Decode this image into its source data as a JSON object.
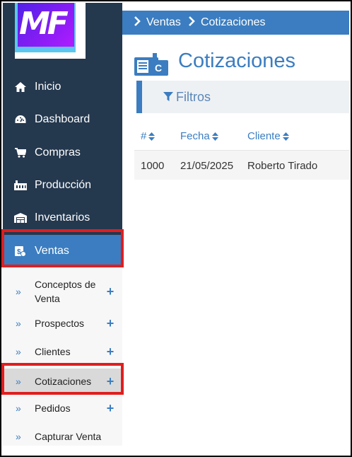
{
  "logo": {
    "text": "MF"
  },
  "breadcrumb": {
    "items": [
      "Ventas",
      "Cotizaciones"
    ]
  },
  "page": {
    "title": "Cotizaciones",
    "title_icon_letter": "C"
  },
  "filters": {
    "label": "Filtros"
  },
  "nav": {
    "items": [
      {
        "label": "Inicio",
        "icon": "home-icon"
      },
      {
        "label": "Dashboard",
        "icon": "dashboard-icon"
      },
      {
        "label": "Compras",
        "icon": "cart-icon"
      },
      {
        "label": "Producción",
        "icon": "industry-icon"
      },
      {
        "label": "Inventarios",
        "icon": "warehouse-icon"
      },
      {
        "label": "Ventas",
        "icon": "sales-icon"
      }
    ],
    "active": "Ventas"
  },
  "subnav": {
    "items": [
      {
        "label": "Conceptos de Venta",
        "has_add": true
      },
      {
        "label": "Prospectos",
        "has_add": true
      },
      {
        "label": "Clientes",
        "has_add": true
      },
      {
        "label": "Cotizaciones",
        "has_add": true
      },
      {
        "label": "Pedidos",
        "has_add": true
      },
      {
        "label": "Capturar Venta",
        "has_add": false
      }
    ],
    "chevron": "»",
    "plus": "+",
    "active": "Cotizaciones"
  },
  "table": {
    "columns": [
      "#",
      "Fecha",
      "Cliente"
    ],
    "rows": [
      {
        "id": "1000",
        "fecha": "21/05/2025",
        "cliente": "Roberto Tirado"
      }
    ]
  },
  "colors": {
    "accent": "#3b7dc0",
    "sidebar": "#24384e",
    "highlight": "#e01e1e"
  }
}
